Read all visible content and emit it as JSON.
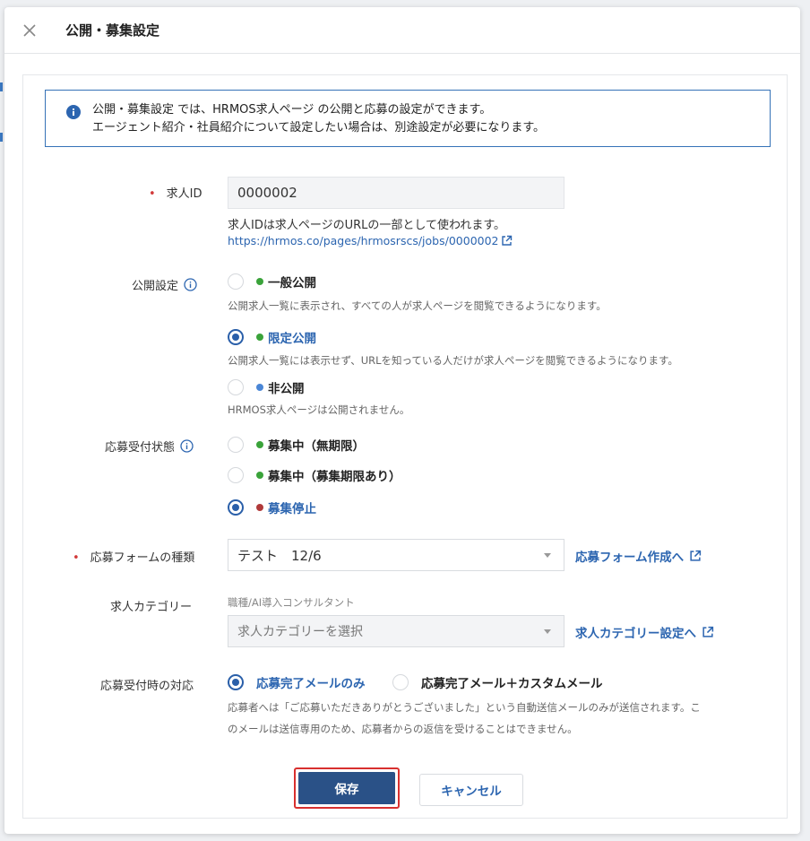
{
  "dialog": {
    "title": "公開・募集設定"
  },
  "info": {
    "line1": "公開・募集設定 では、HRMOS求人ページ の公開と応募の設定ができます。",
    "line2": "エージェント紹介・社員紹介について設定したい場合は、別途設定が必要になります。"
  },
  "job_id": {
    "label": "求人ID",
    "value": "0000002",
    "help": "求人IDは求人ページのURLの一部として使われます。",
    "url": "https://hrmos.co/pages/hrmosrscs/jobs/0000002"
  },
  "visibility": {
    "label": "公開設定",
    "options": [
      {
        "label": "一般公開",
        "desc": "公開求人一覧に表示され、すべての人が求人ページを閲覧できるようになります。",
        "selected": false,
        "dot_color": "#3aa33a"
      },
      {
        "label": "限定公開",
        "desc": "公開求人一覧には表示せず、URLを知っている人だけが求人ページを閲覧できるようになります。",
        "selected": true,
        "dot_color": "#3aa33a"
      },
      {
        "label": "非公開",
        "desc": "HRMOS求人ページは公開されません。",
        "selected": false,
        "dot_color": "#4a86d6"
      }
    ]
  },
  "recruit_status": {
    "label": "応募受付状態",
    "options": [
      {
        "label": "募集中（無期限）",
        "selected": false,
        "dot_color": "#3aa33a"
      },
      {
        "label": "募集中（募集期限あり）",
        "selected": false,
        "dot_color": "#3aa33a"
      },
      {
        "label": "募集停止",
        "selected": true,
        "dot_color": "#b03a3a"
      }
    ]
  },
  "form_type": {
    "label": "応募フォームの種類",
    "value": "テスト　12/6",
    "link": "応募フォーム作成へ"
  },
  "category": {
    "label": "求人カテゴリー",
    "current": "職種/AI導入コンサルタント",
    "placeholder": "求人カテゴリーを選択",
    "link": "求人カテゴリー設定へ"
  },
  "response": {
    "label": "応募受付時の対応",
    "option1": "応募完了メールのみ",
    "option2": "応募完了メール＋カスタムメール",
    "desc1": "応募者へは「ご応募いただきありがとうございました」という自動送信メールのみが送信されます。こ",
    "desc2": "のメールは送信専用のため、応募者からの返信を受けることはできません。"
  },
  "buttons": {
    "save": "保存",
    "cancel": "キャンセル"
  },
  "colors": {
    "accent": "#2a5187",
    "link": "#2c65b0",
    "required": "#d23a3a",
    "highlight": "#d8302f"
  }
}
